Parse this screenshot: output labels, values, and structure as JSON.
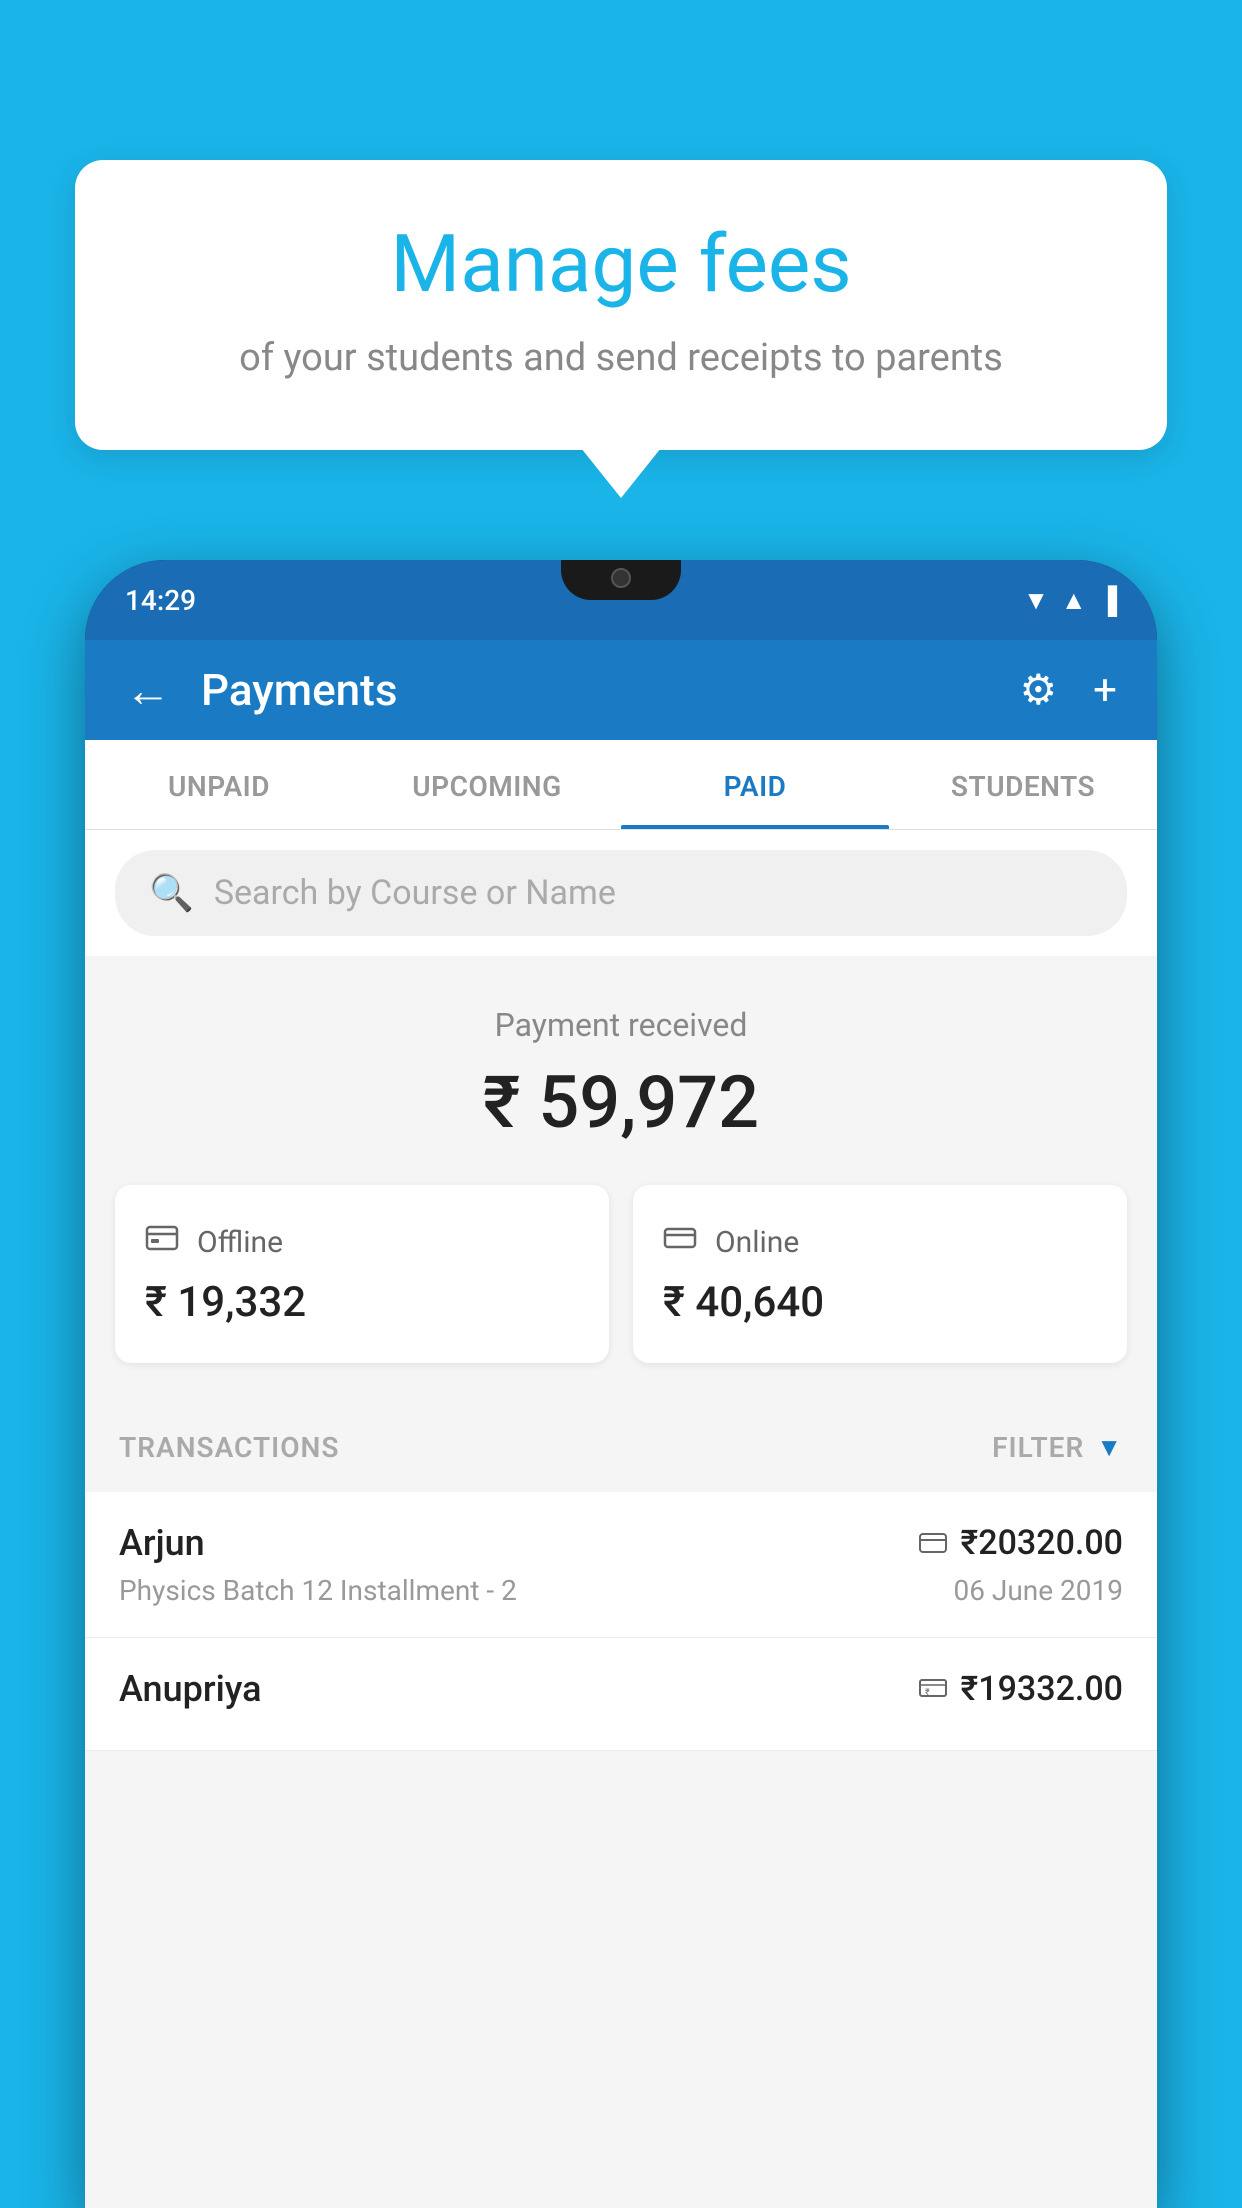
{
  "bubble": {
    "title": "Manage fees",
    "subtitle": "of your students and send receipts to parents"
  },
  "status_bar": {
    "time": "14:29"
  },
  "header": {
    "title": "Payments",
    "back_label": "←",
    "settings_label": "⚙",
    "add_label": "+"
  },
  "tabs": [
    {
      "id": "unpaid",
      "label": "UNPAID",
      "active": false
    },
    {
      "id": "upcoming",
      "label": "UPCOMING",
      "active": false
    },
    {
      "id": "paid",
      "label": "PAID",
      "active": true
    },
    {
      "id": "students",
      "label": "STUDENTS",
      "active": false
    }
  ],
  "search": {
    "placeholder": "Search by Course or Name"
  },
  "payment_summary": {
    "label": "Payment received",
    "amount": "₹ 59,972"
  },
  "payment_modes": [
    {
      "id": "offline",
      "icon": "₹",
      "name": "Offline",
      "amount": "₹ 19,332"
    },
    {
      "id": "online",
      "icon": "▬",
      "name": "Online",
      "amount": "₹ 40,640"
    }
  ],
  "transactions_section": {
    "label": "TRANSACTIONS",
    "filter_label": "FILTER"
  },
  "transactions": [
    {
      "name": "Arjun",
      "course": "Physics Batch 12 Installment - 2",
      "amount": "₹20320.00",
      "date": "06 June 2019",
      "payment_type": "card"
    },
    {
      "name": "Anupriya",
      "course": "",
      "amount": "₹19332.00",
      "date": "",
      "payment_type": "cash"
    }
  ]
}
